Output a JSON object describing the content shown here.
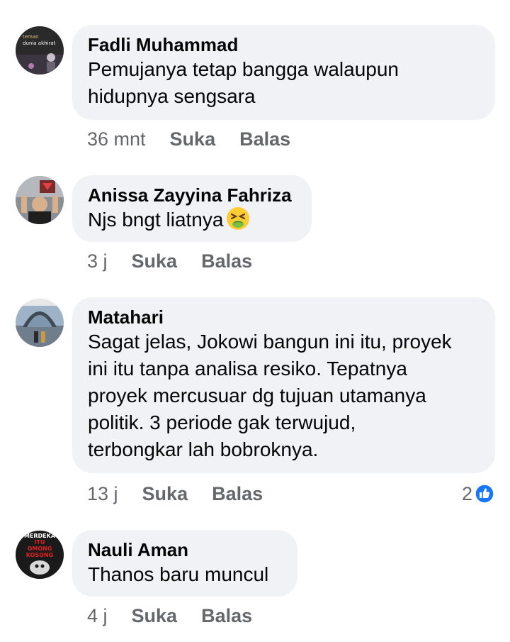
{
  "colors": {
    "bubble": "#f0f2f5",
    "meta": "#65676b",
    "like_blue": "#1877f2"
  },
  "comments": [
    {
      "author": "Fadli Muhammad",
      "lines": [
        "Pemujanya tetap bangga walaupun",
        "hidupnya sengsara"
      ],
      "time": "36 mnt",
      "like_label": "Suka",
      "reply_label": "Balas",
      "avatar_text": [
        "teman",
        "dunia akhirat"
      ]
    },
    {
      "author": "Anissa Zayyina Fahriza",
      "lines": [
        "Njs bngt liatnya"
      ],
      "emoji": "nauseated-face-icon",
      "time": "3 j",
      "like_label": "Suka",
      "reply_label": "Balas"
    },
    {
      "author": "Matahari",
      "lines": [
        "Sagat jelas, Jokowi bangun ini itu, proyek",
        "ini itu tanpa analisa resiko. Tepatnya",
        "proyek mercusuar dg tujuan utamanya",
        "politik. 3 periode gak terwujud,",
        "terbongkar lah bobroknya."
      ],
      "time": "13 j",
      "like_label": "Suka",
      "reply_label": "Balas",
      "reaction_count": "2",
      "reaction_icon": "like-icon"
    },
    {
      "author": "Nauli Aman",
      "lines": [
        "Thanos baru muncul"
      ],
      "time": "4 j",
      "like_label": "Suka",
      "reply_label": "Balas",
      "avatar_text": [
        "MERDEKA",
        "ITU",
        "OMONG",
        "KOSONG"
      ]
    }
  ]
}
